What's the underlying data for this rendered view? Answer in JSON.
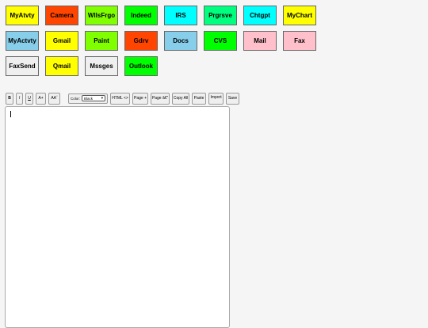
{
  "tiles": [
    [
      {
        "label": "MyAtvty",
        "color": "#ffff00"
      },
      {
        "label": "Camera",
        "color": "#ff4500"
      },
      {
        "label": "WllsFrgo",
        "color": "#7fff00"
      },
      {
        "label": "Indeed",
        "color": "#00ff00"
      },
      {
        "label": "IRS",
        "color": "#00ffff"
      },
      {
        "label": "Prgrsve",
        "color": "#00ff7f"
      },
      {
        "label": "Chtgpt",
        "color": "#00ffff"
      },
      {
        "label": "MyChart",
        "color": "#ffff00"
      }
    ],
    [
      {
        "label": "MyActvty",
        "color": "#87ceeb"
      },
      {
        "label": "Gmail",
        "color": "#ffff00"
      },
      {
        "label": "Paint",
        "color": "#7fff00"
      },
      {
        "label": "Gdrv",
        "color": "#ff4500"
      },
      {
        "label": "Docs",
        "color": "#87ceeb"
      },
      {
        "label": "CVS",
        "color": "#00ff00"
      },
      {
        "label": "Mail",
        "color": "#ffc0cb"
      },
      {
        "label": "Fax",
        "color": "#ffc0cb"
      }
    ],
    [
      {
        "label": "FaxSend",
        "color": "#efefef"
      },
      {
        "label": "Qmail",
        "color": "#ffff00"
      },
      {
        "label": "Mssges",
        "color": "#efefef"
      },
      {
        "label": "Outlook",
        "color": "#00ff00"
      }
    ]
  ],
  "toolbar": {
    "bold": "B",
    "italic": "I",
    "underline": "U",
    "font_bigger": "A+",
    "font_smaller": "AAˇ",
    "color_label": "Color:",
    "color_value": "Black",
    "html": "HTML <>",
    "page_plus": "Page +",
    "page_minus": "Page â€”",
    "copy_all": "Copy All",
    "paste": "Paste",
    "import": "Import",
    "save": "Save"
  },
  "editor": {
    "value": ""
  }
}
